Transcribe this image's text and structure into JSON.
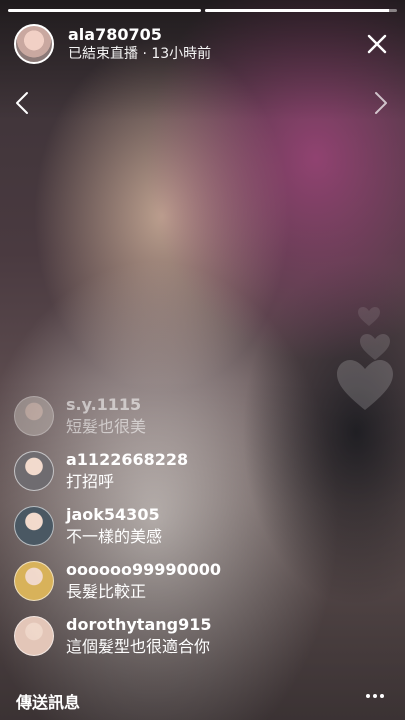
{
  "progress": [
    1.0,
    0.96
  ],
  "header": {
    "username": "ala780705",
    "status": "已結束直播 · 13小時前"
  },
  "comments": [
    {
      "user": "s.y.1115",
      "text": "短髮也很美",
      "avatar_color": "#b9b0ab",
      "faded": true
    },
    {
      "user": "a1122668228",
      "text": "打招呼",
      "avatar_color": "#6f6c70",
      "faded": false
    },
    {
      "user": "jaok54305",
      "text": "不一樣的美感",
      "avatar_color": "#4a5863",
      "faded": false
    },
    {
      "user": "oooooo99990000",
      "text": "長髮比較正",
      "avatar_color": "#d8b25a",
      "faded": false
    },
    {
      "user": "dorothytang915",
      "text": "這個髮型也很適合你",
      "avatar_color": "#e3c6b8",
      "faded": false
    }
  ],
  "bottom_bar": {
    "send_label": "傳送訊息"
  },
  "icons": {
    "close": "close-icon",
    "prev": "chevron-left-icon",
    "next": "chevron-right-icon",
    "more": "more-horizontal-icon"
  }
}
